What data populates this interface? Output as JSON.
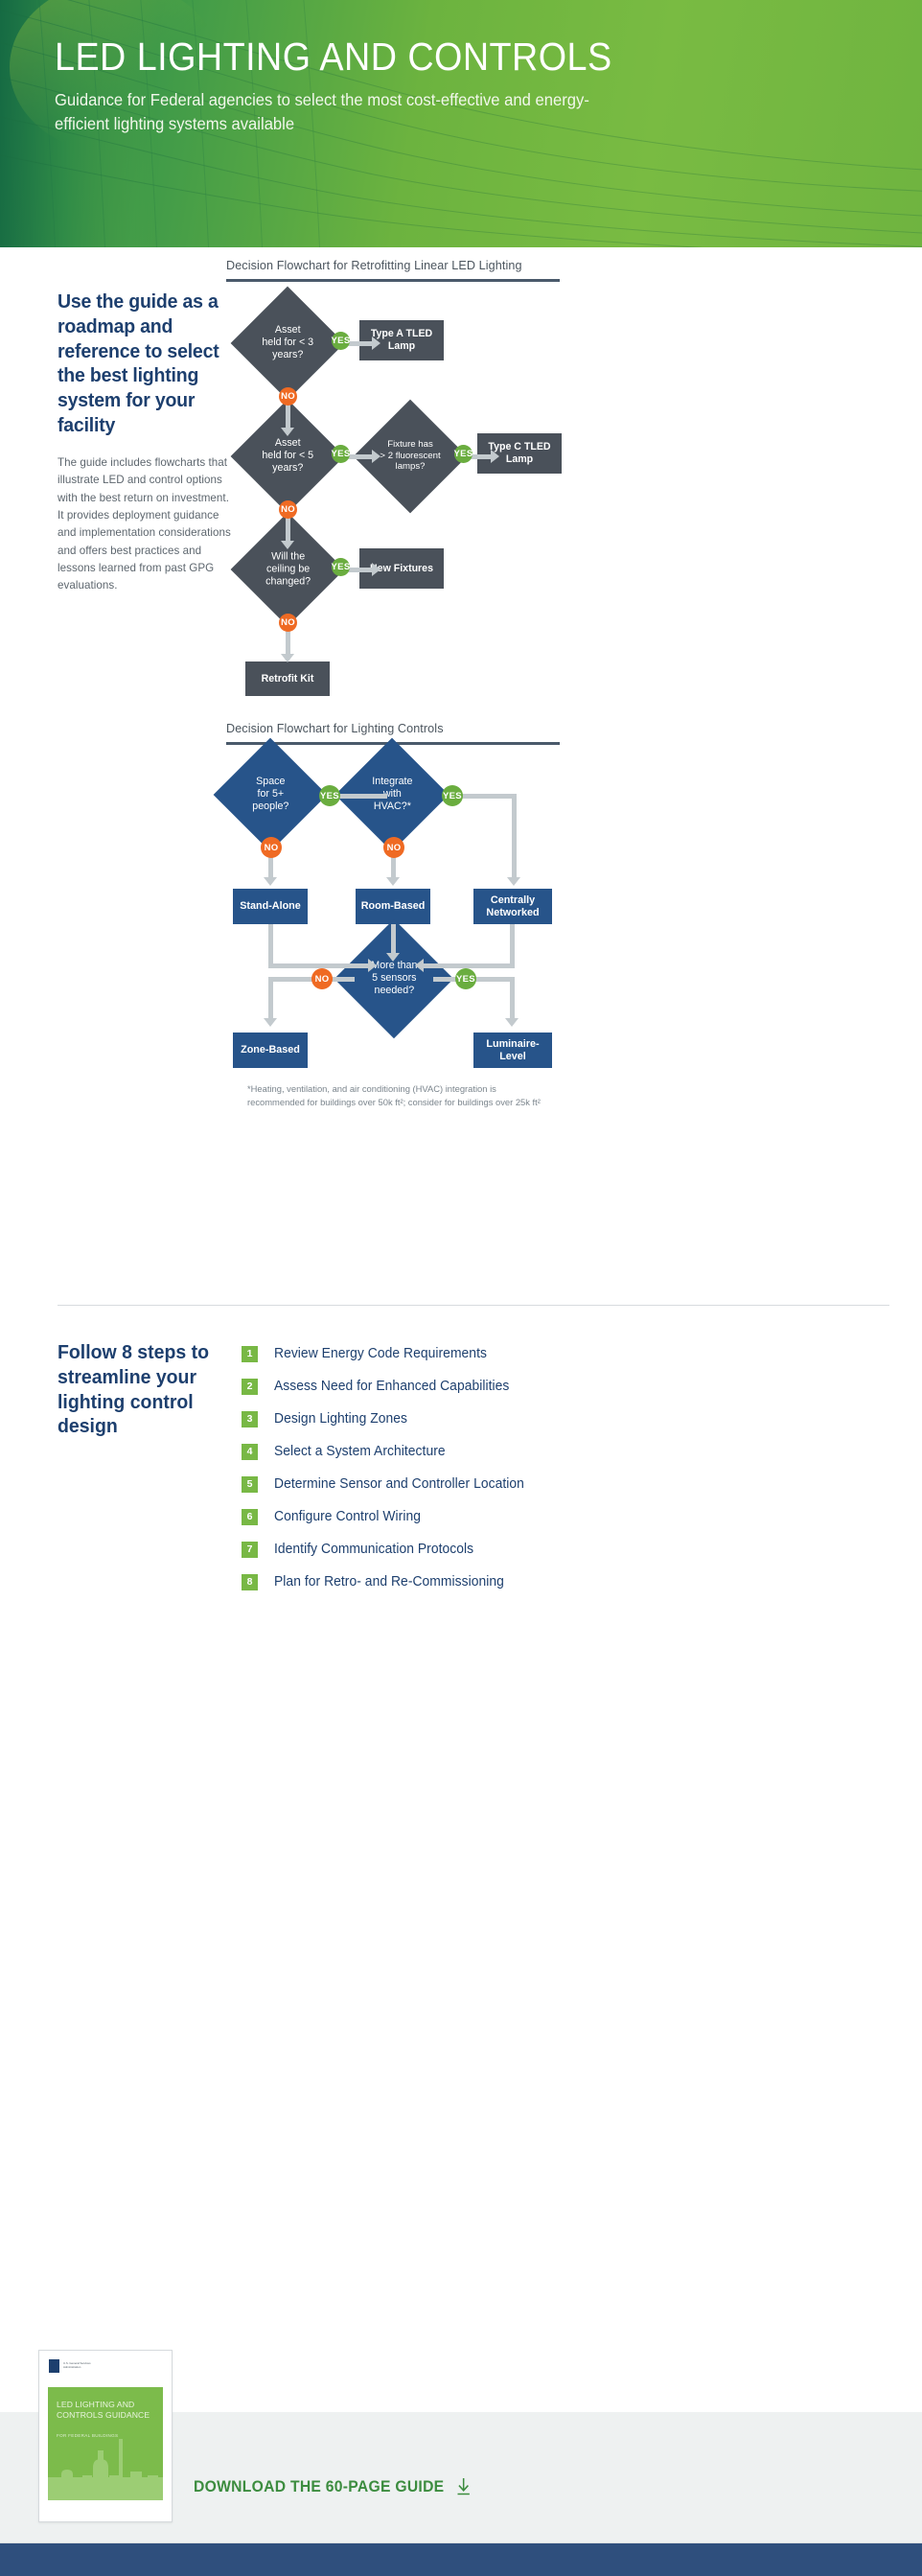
{
  "header": {
    "title": "LED LIGHTING AND CONTROLS",
    "subtitle": "Guidance for Federal agencies to select the most cost-effective and energy-efficient lighting systems available"
  },
  "intro": {
    "heading": "Use the guide as a roadmap and reference to select the best lighting system for your facility",
    "body": "The guide includes flowcharts that illustrate LED and control options with the best return on investment. It provides deployment guidance and implementation considerations and offers best practices and lessons learned from past GPG evaluations."
  },
  "flowchart_retrofit": {
    "title": "Decision Flowchart for Retrofitting Linear LED Lighting",
    "nodes": {
      "d1": "Asset\nheld for < 3\nyears?",
      "d2": "Asset\nheld for < 5\nyears?",
      "d3": "Fixture has\n> 2 fluorescent\nlamps?",
      "d4": "Will the\nceiling be\nchanged?",
      "b1": "Type A TLED\nLamp",
      "b2": "Type C TLED\nLamp",
      "b3": "New Fixtures",
      "b4": "Retrofit Kit"
    },
    "labels": {
      "yes": "YES",
      "no": "NO"
    }
  },
  "flowchart_controls": {
    "title": "Decision Flowchart for Lighting Controls",
    "nodes": {
      "d1": "Space\nfor 5+\npeople?",
      "d2": "Integrate\nwith\nHVAC?*",
      "d3": "More than\n5 sensors\nneeded?",
      "b1": "Stand-Alone",
      "b2": "Room-Based",
      "b3": "Centrally\nNetworked",
      "b4": "Zone-Based",
      "b5": "Luminaire-\nLevel"
    },
    "labels": {
      "yes": "YES",
      "no": "NO"
    },
    "footnote": "*Heating, ventilation, and air conditioning (HVAC) integration is recommended for buildings over 50k ft²; consider for buildings over 25k ft²"
  },
  "steps_section": {
    "heading": "Follow 8 steps to streamline your lighting control design",
    "items": [
      {
        "num": "1",
        "label": "Review Energy Code Requirements"
      },
      {
        "num": "2",
        "label": "Assess Need for Enhanced Capabilities"
      },
      {
        "num": "3",
        "label": "Design Lighting Zones"
      },
      {
        "num": "4",
        "label": "Select a System Architecture"
      },
      {
        "num": "5",
        "label": "Determine Sensor and Controller Location"
      },
      {
        "num": "6",
        "label": "Configure Control Wiring"
      },
      {
        "num": "7",
        "label": "Identify Communication Protocols"
      },
      {
        "num": "8",
        "label": "Plan for Retro- and Re-Commissioning"
      }
    ]
  },
  "footer": {
    "cover": {
      "logo_text": "U.S. General Services\nAdministration",
      "title": "LED LIGHTING AND\nCONTROLS GUIDANCE",
      "subtitle": "FOR FEDERAL BUILDINGS"
    },
    "download_label": "DOWNLOAD THE 60-PAGE GUIDE",
    "download_icon": "download-arrow-icon"
  },
  "colors": {
    "green_brand": "#6cb33f",
    "navy": "#1d3f6e",
    "gray_node": "#4a515a",
    "blue_node": "#27548a",
    "yes_green": "#6aad3f",
    "no_orange": "#ef6a23",
    "connector": "#c3cace"
  }
}
